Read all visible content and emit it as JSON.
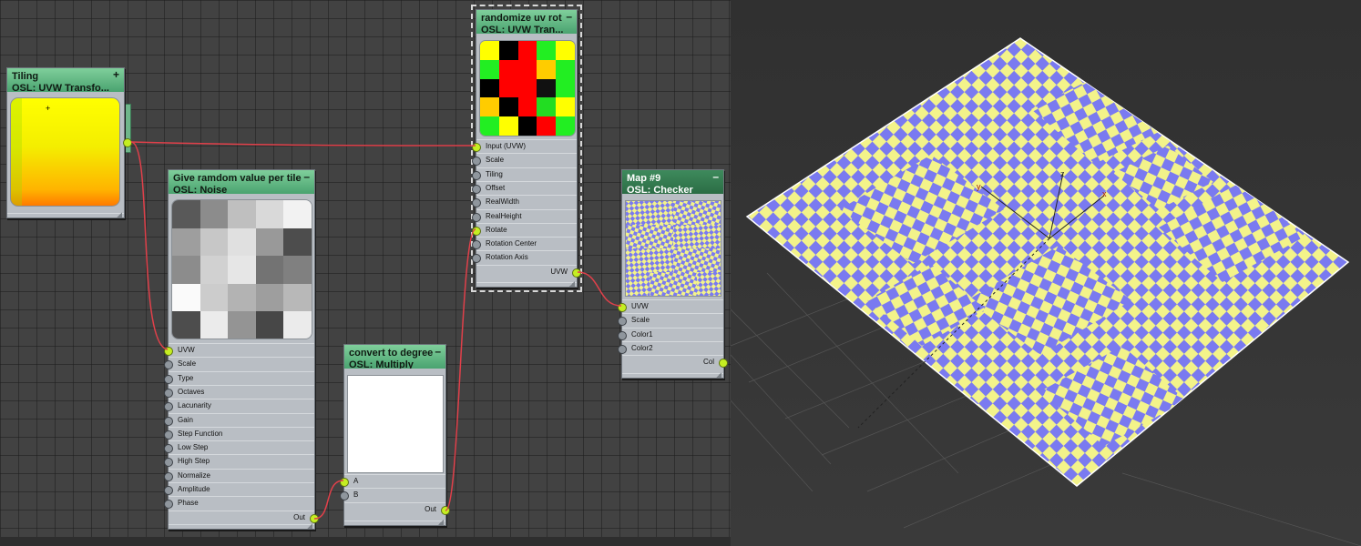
{
  "graph": {
    "nodes": [
      {
        "id": "tiling",
        "title": "Tiling",
        "subtitle": "OSL:  UVW Transfo...",
        "button": "+"
      },
      {
        "id": "noise",
        "title": "Give ramdom value per tile",
        "subtitle": "OSL: Noise",
        "button": "–",
        "ports": [
          "UVW",
          "Scale",
          "Type",
          "Octaves",
          "Lacunarity",
          "Gain",
          "Step Function",
          "Low Step",
          "High Step",
          "Normalize",
          "Amplitude",
          "Phase"
        ],
        "output": "Out"
      },
      {
        "id": "multiply",
        "title": "convert to degree",
        "subtitle": "OSL: Multiply",
        "button": "–",
        "ports": [
          "A",
          "B"
        ],
        "output": "Out"
      },
      {
        "id": "rot",
        "title": "randomize uv rot",
        "subtitle": "OSL:  UVW Tran...",
        "button": "–",
        "ports": [
          "Input (UVW)",
          "Scale",
          "Tiling",
          "Offset",
          "RealWidth",
          "RealHeight",
          "Rotate",
          "Rotation Center",
          "Rotation Axis"
        ],
        "output": "UVW"
      },
      {
        "id": "checker",
        "title": "Map #9",
        "subtitle": "OSL: Checker",
        "button": "–",
        "ports": [
          "UVW",
          "Scale",
          "Color1",
          "Color2"
        ],
        "output": "Col"
      }
    ]
  },
  "colors": {
    "header_green": "#5fb883",
    "port_connected": "#c5ee22",
    "wire": "#e0404a",
    "checker_a": "#f3f38a",
    "checker_b": "#7a7af0"
  }
}
